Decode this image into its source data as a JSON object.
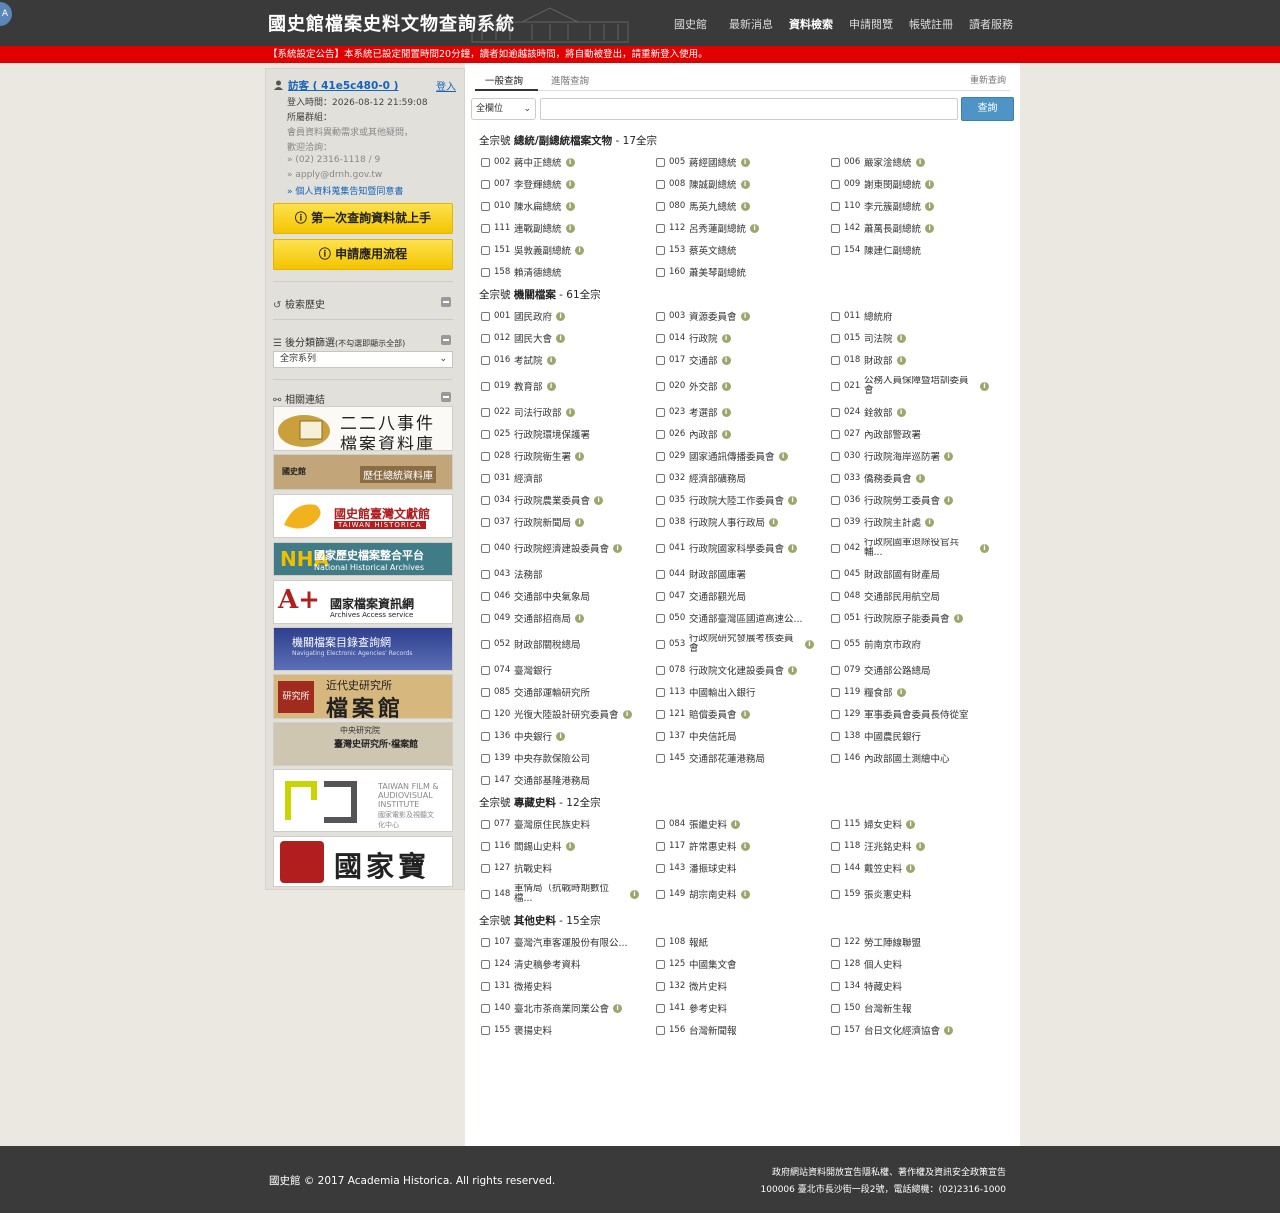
{
  "header": {
    "title": "國史館檔案史料文物查詢系統",
    "nav": [
      "國史館",
      "最新消息",
      "資料檢索",
      "申請閱覽",
      "帳號註冊",
      "讀者服務"
    ],
    "active_nav": "資料檢索",
    "bubble": "A"
  },
  "notice": "【系統設定公告】本系統已設定閒置時間20分鐘，讀者如逾越該時間，將自動被登出，請重新登入使用。",
  "user": {
    "name": "訪客 ( 41e5c480-0 )",
    "login": "登入",
    "login_time": "登入時間：2026-08-12 21:59:08",
    "group": "所屬群組：",
    "help1": "會員資料異動需求或其他疑問，",
    "help2": "歡迎洽詢：",
    "phone": "» (02) 2316-1118 / 9",
    "email": "» apply@drnh.gov.tw",
    "privacy": "» 個人資料蒐集告知暨同意書"
  },
  "buttons": {
    "first_query": "第一次查詢資料就上手",
    "apply_flow": "申請應用流程"
  },
  "sidebar": {
    "history": "檢索歷史",
    "filter": "後分類篩選",
    "filter_note": "(不勾選即顯示全部)",
    "filter_value": "全宗系列",
    "links_title": "相關連結",
    "links": [
      {
        "t1": "二二八事件",
        "t2": "檔案資料庫"
      },
      {
        "t1": "國史館",
        "t2": "歷任總統資料庫"
      },
      {
        "t1": "國史館臺灣文獻館",
        "t2": "TAIWAN HISTORICA"
      },
      {
        "t1": "國家歷史檔案整合平台",
        "t2": "National Historical Archives"
      },
      {
        "t1": "國家檔案資訊網",
        "t2": "Archives Access service"
      },
      {
        "t1": "機關檔案目錄查詢網",
        "t2": "Navigating Electronic Agencies' Records"
      },
      {
        "t1": "近代史研究所",
        "t2": "檔案館"
      },
      {
        "t1": "中央研究院",
        "t2": "臺灣史研究所‧檔案館"
      },
      {
        "t1": "TAIWAN FILM & AUDIOVISUAL INSTITUTE",
        "t2": "國家電影及視聽文化中心"
      },
      {
        "t1": "國家寶藏",
        "t2": ""
      }
    ]
  },
  "search": {
    "tab_general": "一般查詢",
    "tab_advanced": "進階查詢",
    "reset": "重新查詢",
    "field": "全欄位",
    "button": "查詢",
    "info_icon": "i"
  },
  "groups": [
    {
      "prefix": "全宗號",
      "title": "總統/副總統檔案文物",
      "count": " - 17全宗",
      "rows": [
        [
          {
            "code": "002",
            "name": "蔣中正總統",
            "info": true
          },
          {
            "code": "005",
            "name": "蔣經國總統",
            "info": true
          },
          {
            "code": "006",
            "name": "嚴家淦總統",
            "info": true
          }
        ],
        [
          {
            "code": "007",
            "name": "李登輝總統",
            "info": true
          },
          {
            "code": "008",
            "name": "陳誠副總統",
            "info": true
          },
          {
            "code": "009",
            "name": "謝東閔副總統",
            "info": true
          }
        ],
        [
          {
            "code": "010",
            "name": "陳水扁總統",
            "info": true
          },
          {
            "code": "080",
            "name": "馬英九總統",
            "info": true
          },
          {
            "code": "110",
            "name": "李元簇副總統",
            "info": true
          }
        ],
        [
          {
            "code": "111",
            "name": "連戰副總統",
            "info": true
          },
          {
            "code": "112",
            "name": "呂秀蓮副總統",
            "info": true
          },
          {
            "code": "142",
            "name": "蕭萬長副總統",
            "info": true
          }
        ],
        [
          {
            "code": "151",
            "name": "吳敦義副總統",
            "info": true
          },
          {
            "code": "153",
            "name": "蔡英文總統",
            "info": false
          },
          {
            "code": "154",
            "name": "陳建仁副總統",
            "info": false
          }
        ],
        [
          {
            "code": "158",
            "name": "賴清德總統",
            "info": false
          },
          {
            "code": "160",
            "name": "蕭美琴副總統",
            "info": false
          }
        ]
      ]
    },
    {
      "prefix": "全宗號",
      "title": "機關檔案",
      "count": " - 61全宗",
      "rows": [
        [
          {
            "code": "001",
            "name": "國民政府",
            "info": true
          },
          {
            "code": "003",
            "name": "資源委員會",
            "info": true
          },
          {
            "code": "011",
            "name": "總統府",
            "info": false
          }
        ],
        [
          {
            "code": "012",
            "name": "國民大會",
            "info": true
          },
          {
            "code": "014",
            "name": "行政院",
            "info": true
          },
          {
            "code": "015",
            "name": "司法院",
            "info": true
          }
        ],
        [
          {
            "code": "016",
            "name": "考試院",
            "info": true
          },
          {
            "code": "017",
            "name": "交通部",
            "info": true
          },
          {
            "code": "018",
            "name": "財政部",
            "info": true
          }
        ],
        [
          {
            "code": "019",
            "name": "教育部",
            "info": true
          },
          {
            "code": "020",
            "name": "外交部",
            "info": true
          },
          {
            "code": "021",
            "name": "公務人員保障暨培訓委員會",
            "info": true,
            "two": true
          }
        ],
        [
          {
            "code": "022",
            "name": "司法行政部",
            "info": true
          },
          {
            "code": "023",
            "name": "考選部",
            "info": true
          },
          {
            "code": "024",
            "name": "銓敘部",
            "info": true
          }
        ],
        [
          {
            "code": "025",
            "name": "行政院環境保護署",
            "info": false
          },
          {
            "code": "026",
            "name": "內政部",
            "info": true
          },
          {
            "code": "027",
            "name": "內政部警政署",
            "info": false
          }
        ],
        [
          {
            "code": "028",
            "name": "行政院衛生署",
            "info": true
          },
          {
            "code": "029",
            "name": "國家通訊傳播委員會",
            "info": true
          },
          {
            "code": "030",
            "name": "行政院海岸巡防署",
            "info": true
          }
        ],
        [
          {
            "code": "031",
            "name": "經濟部",
            "info": false
          },
          {
            "code": "032",
            "name": "經濟部礦務局",
            "info": false
          },
          {
            "code": "033",
            "name": "僑務委員會",
            "info": true
          }
        ],
        [
          {
            "code": "034",
            "name": "行政院農業委員會",
            "info": true
          },
          {
            "code": "035",
            "name": "行政院大陸工作委員會",
            "info": true
          },
          {
            "code": "036",
            "name": "行政院勞工委員會",
            "info": true
          }
        ],
        [
          {
            "code": "037",
            "name": "行政院新聞局",
            "info": true
          },
          {
            "code": "038",
            "name": "行政院人事行政局",
            "info": true
          },
          {
            "code": "039",
            "name": "行政院主計處",
            "info": true
          }
        ],
        [
          {
            "code": "040",
            "name": "行政院經濟建設委員會",
            "info": true
          },
          {
            "code": "041",
            "name": "行政院國家科學委員會",
            "info": true
          },
          {
            "code": "042",
            "name": "行政院國軍退除役官兵輔...",
            "info": true,
            "two": true
          }
        ],
        [
          {
            "code": "043",
            "name": "法務部",
            "info": false
          },
          {
            "code": "044",
            "name": "財政部國庫署",
            "info": false
          },
          {
            "code": "045",
            "name": "財政部國有財產局",
            "info": false
          }
        ],
        [
          {
            "code": "046",
            "name": "交通部中央氣象局",
            "info": false
          },
          {
            "code": "047",
            "name": "交通部觀光局",
            "info": false
          },
          {
            "code": "048",
            "name": "交通部民用航空局",
            "info": false
          }
        ],
        [
          {
            "code": "049",
            "name": "交通部招商局",
            "info": true
          },
          {
            "code": "050",
            "name": "交通部臺灣區國道高速公...",
            "info": false
          },
          {
            "code": "051",
            "name": "行政院原子能委員會",
            "info": true
          }
        ],
        [
          {
            "code": "052",
            "name": "財政部關稅總局",
            "info": false
          },
          {
            "code": "053",
            "name": "行政院研究發展考核委員會",
            "info": true,
            "two": true
          },
          {
            "code": "055",
            "name": "前南京市政府",
            "info": false
          }
        ],
        [
          {
            "code": "074",
            "name": "臺灣銀行",
            "info": false
          },
          {
            "code": "078",
            "name": "行政院文化建設委員會",
            "info": true
          },
          {
            "code": "079",
            "name": "交通部公路總局",
            "info": false
          }
        ],
        [
          {
            "code": "085",
            "name": "交通部運輸研究所",
            "info": false
          },
          {
            "code": "113",
            "name": "中國輸出入銀行",
            "info": false
          },
          {
            "code": "119",
            "name": "糧食部",
            "info": true
          }
        ],
        [
          {
            "code": "120",
            "name": "光復大陸設計研究委員會",
            "info": true
          },
          {
            "code": "121",
            "name": "賠償委員會",
            "info": true
          },
          {
            "code": "129",
            "name": "軍事委員會委員長侍從室",
            "info": false
          }
        ],
        [
          {
            "code": "136",
            "name": "中央銀行",
            "info": true
          },
          {
            "code": "137",
            "name": "中央信託局",
            "info": false
          },
          {
            "code": "138",
            "name": "中國農民銀行",
            "info": false
          }
        ],
        [
          {
            "code": "139",
            "name": "中央存款保險公司",
            "info": false
          },
          {
            "code": "145",
            "name": "交通部花蓮港務局",
            "info": false
          },
          {
            "code": "146",
            "name": "內政部國土測繪中心",
            "info": false
          }
        ],
        [
          {
            "code": "147",
            "name": "交通部基隆港務局",
            "info": false
          }
        ]
      ]
    },
    {
      "prefix": "全宗號",
      "title": "專藏史料",
      "count": " - 12全宗",
      "rows": [
        [
          {
            "code": "077",
            "name": "臺灣原住民族史料",
            "info": false
          },
          {
            "code": "084",
            "name": "張繼史料",
            "info": true
          },
          {
            "code": "115",
            "name": "婦女史料",
            "info": true
          }
        ],
        [
          {
            "code": "116",
            "name": "閻錫山史料",
            "info": true
          },
          {
            "code": "117",
            "name": "許常惠史料",
            "info": true
          },
          {
            "code": "118",
            "name": "汪兆銘史料",
            "info": true
          }
        ],
        [
          {
            "code": "127",
            "name": "抗戰史料",
            "info": false
          },
          {
            "code": "143",
            "name": "潘振球史料",
            "info": false
          },
          {
            "code": "144",
            "name": "戴笠史料",
            "info": true
          }
        ],
        [
          {
            "code": "148",
            "name": "軍情局（抗戰時期數位檔...",
            "info": true,
            "two": true
          },
          {
            "code": "149",
            "name": "胡宗南史料",
            "info": true
          },
          {
            "code": "159",
            "name": "張炎憲史料",
            "info": false
          }
        ]
      ]
    },
    {
      "prefix": "全宗號",
      "title": "其他史料",
      "count": " - 15全宗",
      "rows": [
        [
          {
            "code": "107",
            "name": "臺灣汽車客運股份有限公...",
            "info": false
          },
          {
            "code": "108",
            "name": "報紙",
            "info": false
          },
          {
            "code": "122",
            "name": "勞工陣線聯盟",
            "info": false
          }
        ],
        [
          {
            "code": "124",
            "name": "清史稿參考資料",
            "info": false
          },
          {
            "code": "125",
            "name": "中國集文會",
            "info": false
          },
          {
            "code": "128",
            "name": "個人史料",
            "info": false
          }
        ],
        [
          {
            "code": "131",
            "name": "微捲史料",
            "info": false
          },
          {
            "code": "132",
            "name": "微片史料",
            "info": false
          },
          {
            "code": "134",
            "name": "特藏史料",
            "info": false
          }
        ],
        [
          {
            "code": "140",
            "name": "臺北市茶商業同業公會",
            "info": true
          },
          {
            "code": "141",
            "name": "參考史料",
            "info": false
          },
          {
            "code": "150",
            "name": "台灣新生報",
            "info": false
          }
        ],
        [
          {
            "code": "155",
            "name": "褒揚史料",
            "info": false
          },
          {
            "code": "156",
            "name": "台灣新聞報",
            "info": false
          },
          {
            "code": "157",
            "name": "台日文化經濟協會",
            "info": true
          }
        ]
      ]
    }
  ],
  "footer": {
    "copyright": "國史館 © 2017 Academia Historica. All rights reserved.",
    "policy": "政府網站資料開放宣告隱私權、著作權及資訊安全政策宣告",
    "address": "100006 臺北市長沙街一段2號，電話總機：(02)2316-1000"
  }
}
